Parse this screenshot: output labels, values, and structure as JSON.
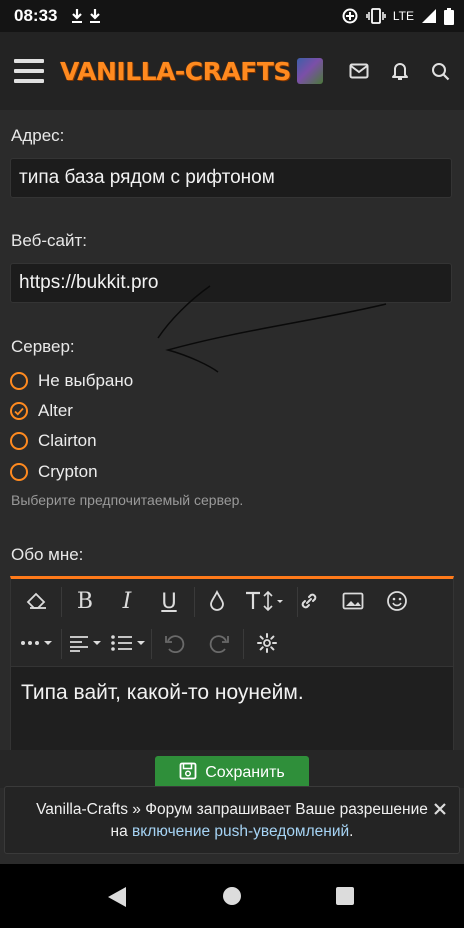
{
  "status_bar": {
    "time": "08:33",
    "network": "LTE"
  },
  "header": {
    "logo_text": "VANILLA-CRAFTS"
  },
  "form": {
    "address_label": "Адрес:",
    "address_value": "типа база рядом с рифтоном",
    "website_label": "Веб-сайт:",
    "website_value": "https://bukkit.pro",
    "server_label": "Сервер:",
    "server_options": [
      {
        "label": "Не выбрано",
        "checked": false
      },
      {
        "label": "Alter",
        "checked": true
      },
      {
        "label": "Clairton",
        "checked": false
      },
      {
        "label": "Crypton",
        "checked": false
      }
    ],
    "server_hint": "Выберите предпочитаемый сервер.",
    "about_label": "Обо мне:",
    "about_value": "Типа вайт, какой-то ноунейм."
  },
  "actions": {
    "save_label": "Сохранить"
  },
  "notice": {
    "text_prefix": "Vanilla-Crafts » Форум запрашивает Ваше разрешение на",
    "link_text": "включение push-уведомлений",
    "text_suffix": "."
  },
  "colors": {
    "accent": "#ff8a1f",
    "save_button": "#2f8f3a",
    "link": "#a6d4f5"
  }
}
